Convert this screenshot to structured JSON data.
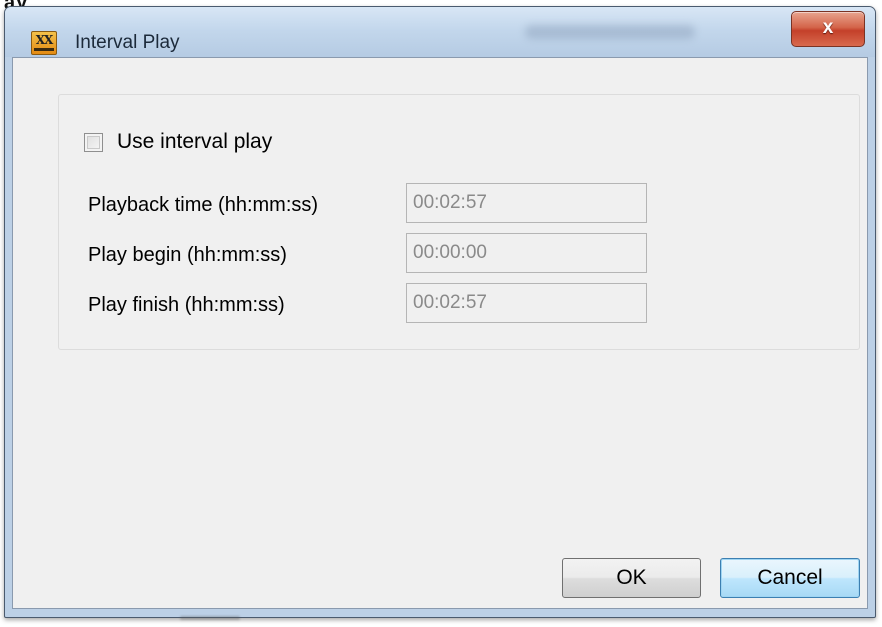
{
  "background": {
    "partial_text": "ay"
  },
  "window": {
    "title": "Interval Play",
    "close_label": "x",
    "icon_text": "XX"
  },
  "interval": {
    "checkbox_label": "Use interval play",
    "checked": false,
    "fields": [
      {
        "label": "Playback time (hh:mm:ss)",
        "value": "00:02:57"
      },
      {
        "label": "Play begin (hh:mm:ss)",
        "value": "00:00:00"
      },
      {
        "label": "Play finish (hh:mm:ss)",
        "value": "00:02:57"
      }
    ]
  },
  "buttons": {
    "ok": "OK",
    "cancel": "Cancel"
  },
  "colors": {
    "titlebar": "#c3d7ec",
    "close_button": "#c4402a",
    "client_bg": "#f0f0f0",
    "disabled_text": "#8a8a8a"
  }
}
